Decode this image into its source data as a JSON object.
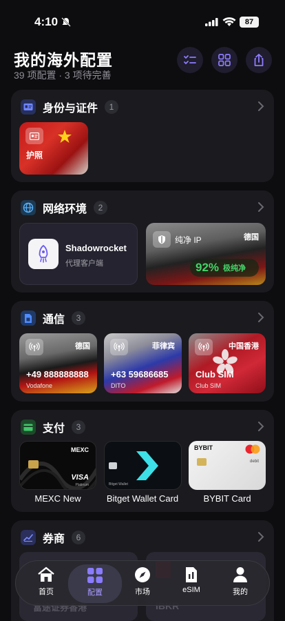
{
  "status": {
    "time": "4:10",
    "battery": "87"
  },
  "header": {
    "title": "我的海外配置",
    "subtitle": "39 项配置 · 3 项待完善"
  },
  "sections": [
    {
      "title": "身份与证件",
      "count": "1",
      "items": [
        {
          "label": "护照"
        }
      ]
    },
    {
      "title": "网络环境",
      "count": "2",
      "app": {
        "name": "Shadowrocket",
        "desc": "代理客户端"
      },
      "ip": {
        "label": "纯净 IP",
        "country": "德国",
        "score": "92%",
        "grade": "极纯净"
      }
    },
    {
      "title": "通信",
      "count": "3",
      "sims": [
        {
          "country": "德国",
          "number": "+49 888888888",
          "carrier": "Vodafone"
        },
        {
          "country": "菲律宾",
          "number": "+63 59686685",
          "carrier": "DITO"
        },
        {
          "country": "中国香港",
          "number": "Club SIM",
          "carrier": "Club SIM"
        }
      ]
    },
    {
      "title": "支付",
      "count": "3",
      "cards": [
        {
          "name": "MEXC New",
          "brand": "MEXC",
          "network": "VISA",
          "tier": "Platinum"
        },
        {
          "name": "Bitget Wallet Card",
          "brand": "Bitget Wallet"
        },
        {
          "name": "BYBIT Card",
          "brand": "BYBIT",
          "type": "debit"
        }
      ]
    },
    {
      "title": "券商",
      "count": "6",
      "peek": [
        "富途证券香港",
        "IBKR"
      ]
    }
  ],
  "tabs": [
    {
      "label": "首页"
    },
    {
      "label": "配置"
    },
    {
      "label": "市场"
    },
    {
      "label": "eSIM"
    },
    {
      "label": "我的"
    }
  ],
  "colors": {
    "accent": "#7b6cf6",
    "background": "#0d0d10",
    "card": "#1a1a1f",
    "good": "#44d36a"
  }
}
